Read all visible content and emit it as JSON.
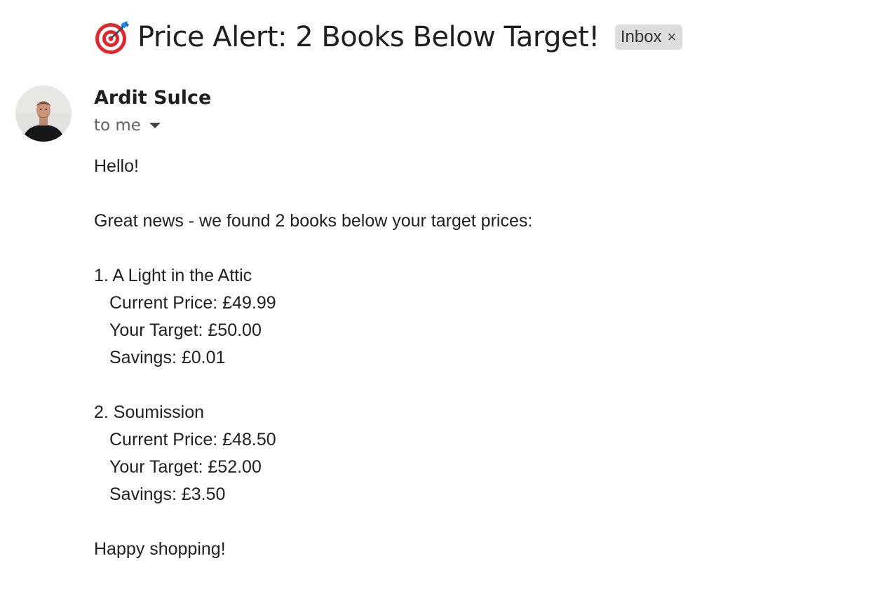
{
  "email": {
    "subject": "Price Alert: 2 Books Below Target!",
    "subject_icon": "direct-hit-target-icon",
    "label": "Inbox",
    "label_close": "×",
    "sender_name": "Ardit Sulce",
    "recipient": "to me",
    "greeting": "Hello!",
    "intro": "Great news - we found 2 books below your target prices:",
    "books": [
      {
        "title": "1. A Light in the Attic",
        "current_price": "Current Price: £49.99",
        "target": "Your Target: £50.00",
        "savings": "Savings: £0.01"
      },
      {
        "title": "2. Soumission",
        "current_price": "Current Price: £48.50",
        "target": "Your Target: £52.00",
        "savings": "Savings: £3.50"
      }
    ],
    "closing": "Happy shopping!"
  },
  "colors": {
    "target_red": "#e0262b",
    "dart_blue": "#1e88e5",
    "chip_bg": "#dddddd"
  }
}
